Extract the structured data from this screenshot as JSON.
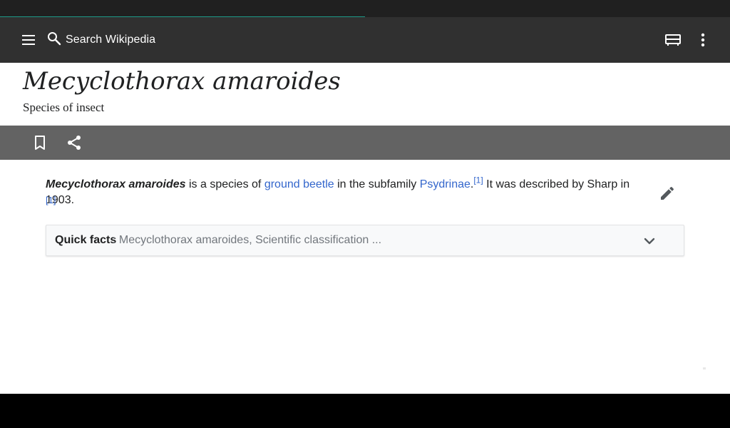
{
  "toolbar": {
    "menu_icon": "hamburger-menu-icon",
    "search_icon": "search-icon",
    "search_placeholder": "Search Wikipedia",
    "reading_lists_icon": "reading-lists-icon",
    "overflow_icon": "more-vert-icon",
    "background": "#303030",
    "progress_color": "#1d9b8a",
    "progress_fraction": 0.5
  },
  "article": {
    "title": "Mecyclothorax amaroides",
    "description": "Species of insect",
    "actions": {
      "bookmark_icon": "bookmark-icon",
      "share_icon": "share-icon"
    },
    "lead": {
      "bold_name": "Mecyclothorax amaroides",
      "text_1": " is a species of ",
      "link_1": "ground beetle",
      "text_2": " in the subfamily ",
      "link_2": "Psydrinae",
      "text_3": ".",
      "ref_1": "[1]",
      "text_4": " It was described by Sharp in 1903.",
      "ref_2": "[1]"
    },
    "edit_icon": "pencil-edit-icon",
    "quick_facts": {
      "label": "Quick facts",
      "description": ": Mecyclothorax amaroides, Scientific classification ...",
      "chevron_icon": "chevron-down-icon"
    },
    "link_color": "#3366cc"
  }
}
